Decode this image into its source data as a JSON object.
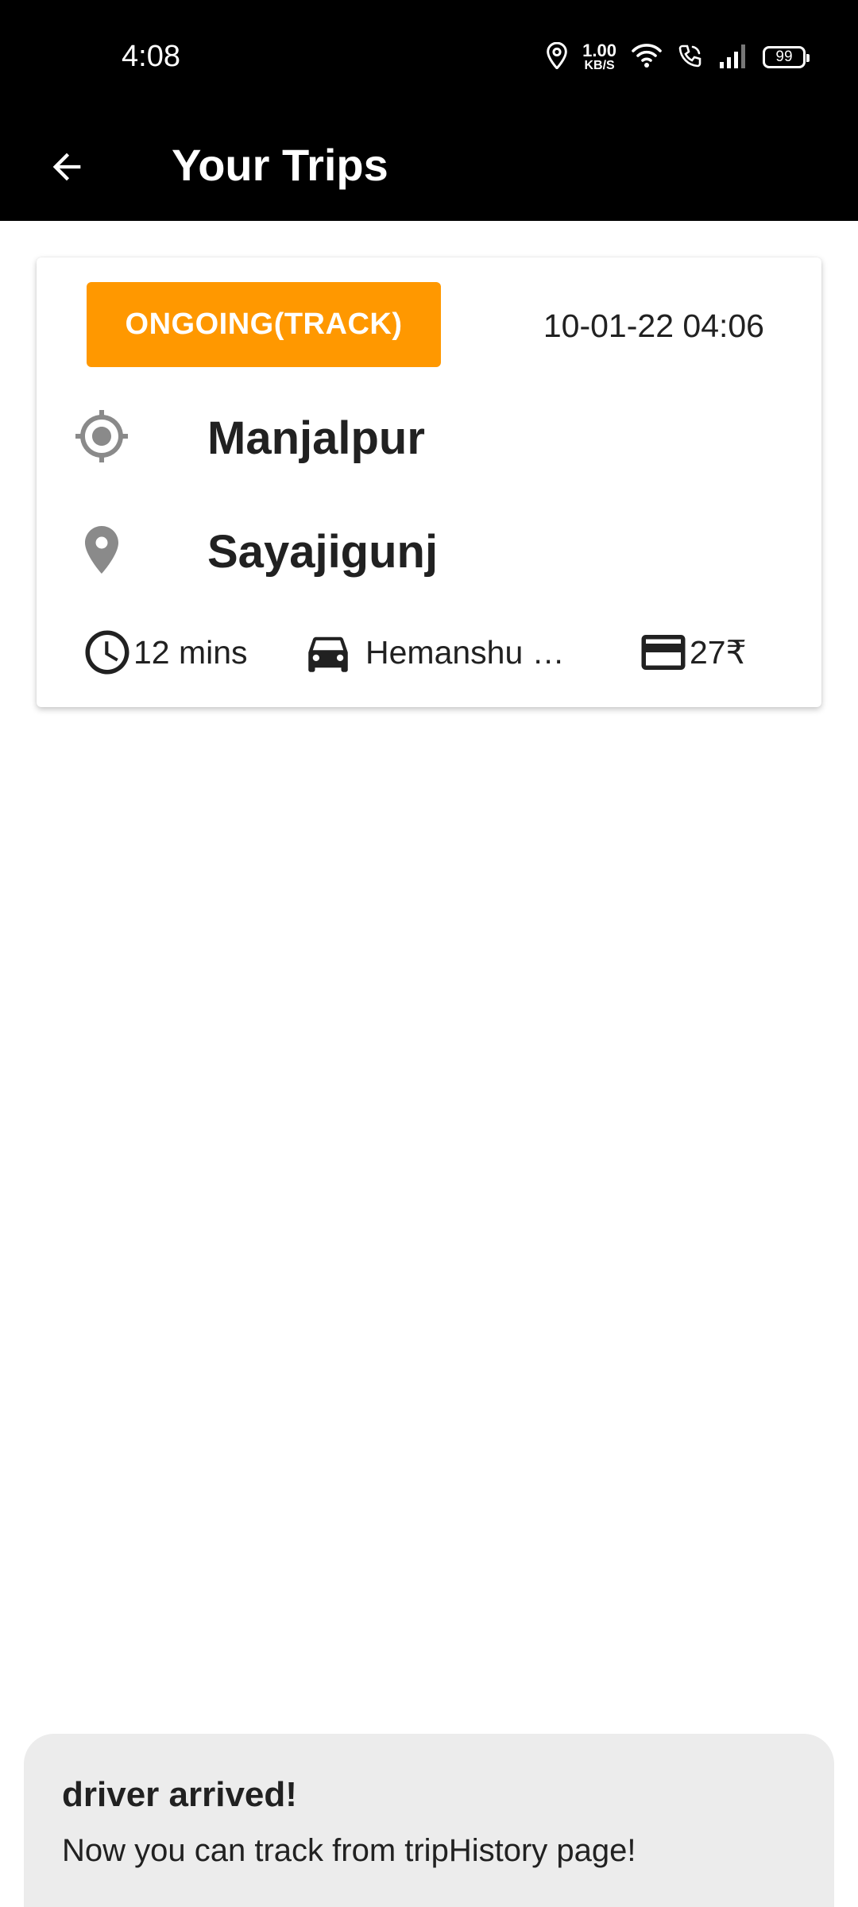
{
  "status_bar": {
    "time": "4:08",
    "net_speed_value": "1.00",
    "net_speed_unit": "KB/S",
    "battery": "99",
    "icons": [
      "location-icon",
      "wifi-icon",
      "wifi-calling-icon",
      "cellular-signal-icon",
      "battery-icon"
    ]
  },
  "app_bar": {
    "title": "Your Trips",
    "back_icon": "arrow-back-icon"
  },
  "trips": [
    {
      "status_label": "ONGOING(TRACK)",
      "datetime": "10-01-22 04:06",
      "pickup": "Manjalpur",
      "dropoff": "Sayajigunj",
      "duration": "12 mins",
      "driver": "Hemanshu …",
      "fare": "27₹",
      "icons": {
        "pickup": "gps-target-icon",
        "dropoff": "map-pin-icon",
        "duration": "clock-icon",
        "driver": "car-icon",
        "fare": "credit-card-icon"
      }
    }
  ],
  "toast": {
    "title": "driver arrived!",
    "message": "Now you can track from tripHistory page!"
  },
  "colors": {
    "status_bar_bg": "#000000",
    "app_bar_bg": "#000000",
    "accent": "#ff9800",
    "icon_gray": "#8a8a8a",
    "text_dark": "#212121",
    "toast_bg": "#ececec"
  }
}
